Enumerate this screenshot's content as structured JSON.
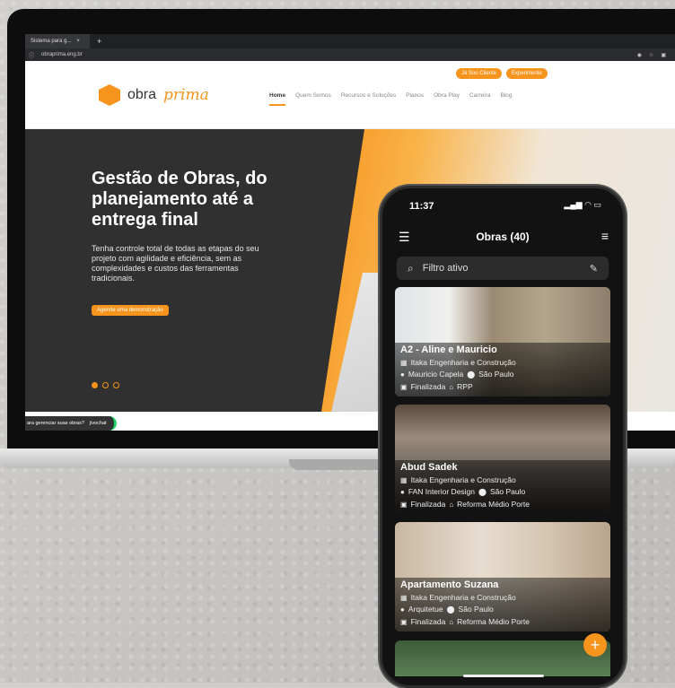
{
  "browser": {
    "tab_title": "Sistema para g...",
    "tab_close": "×",
    "new_tab": "+",
    "url": "obraprima.eng.br"
  },
  "site": {
    "btn_client": "Já Sou Cliente",
    "btn_trial": "Experimente",
    "logo_obra": "obra",
    "logo_prima": "prima",
    "nav": [
      "Home",
      "Quem Somos",
      "Recursos e Soluções",
      "Planos",
      "Obra Play",
      "Carreira",
      "Blog"
    ],
    "hero_title": "Gestão de Obras, do planejamento até a entrega final",
    "hero_text": "Tenha controle total de todas as etapas do seu projeto com agilidade e eficiência, sem as complexidades e custos das ferramentas tradicionais.",
    "cta": "Agende uma demonstração",
    "chat_text": "ara gerenciar suas obras?",
    "chat_brand": "jivochat"
  },
  "phone": {
    "time": "11:37",
    "title": "Obras (40)",
    "search_placeholder": "Filtro ativo",
    "fab": "+",
    "cards": [
      {
        "name": "A2 - Aline e Mauricio",
        "company": "Itaka Engenharia e Construção",
        "person": "Mauricio Capela",
        "city": "São Paulo",
        "status": "Finalizada",
        "type": "RPP"
      },
      {
        "name": "Abud Sadek",
        "company": "Itaka Engenharia e Construção",
        "person": "FAN Interior Design",
        "city": "São Paulo",
        "status": "Finalizada",
        "type": "Reforma Médio Porte"
      },
      {
        "name": "Apartamento Suzana",
        "company": "Itaka Engenharia e Construção",
        "person": "Arquitetue",
        "city": "São Paulo",
        "status": "Finalizada",
        "type": "Reforma Médio Porte"
      }
    ]
  },
  "colors": {
    "accent": "#f7941d",
    "dark": "#303030",
    "whatsapp": "#25d366"
  }
}
